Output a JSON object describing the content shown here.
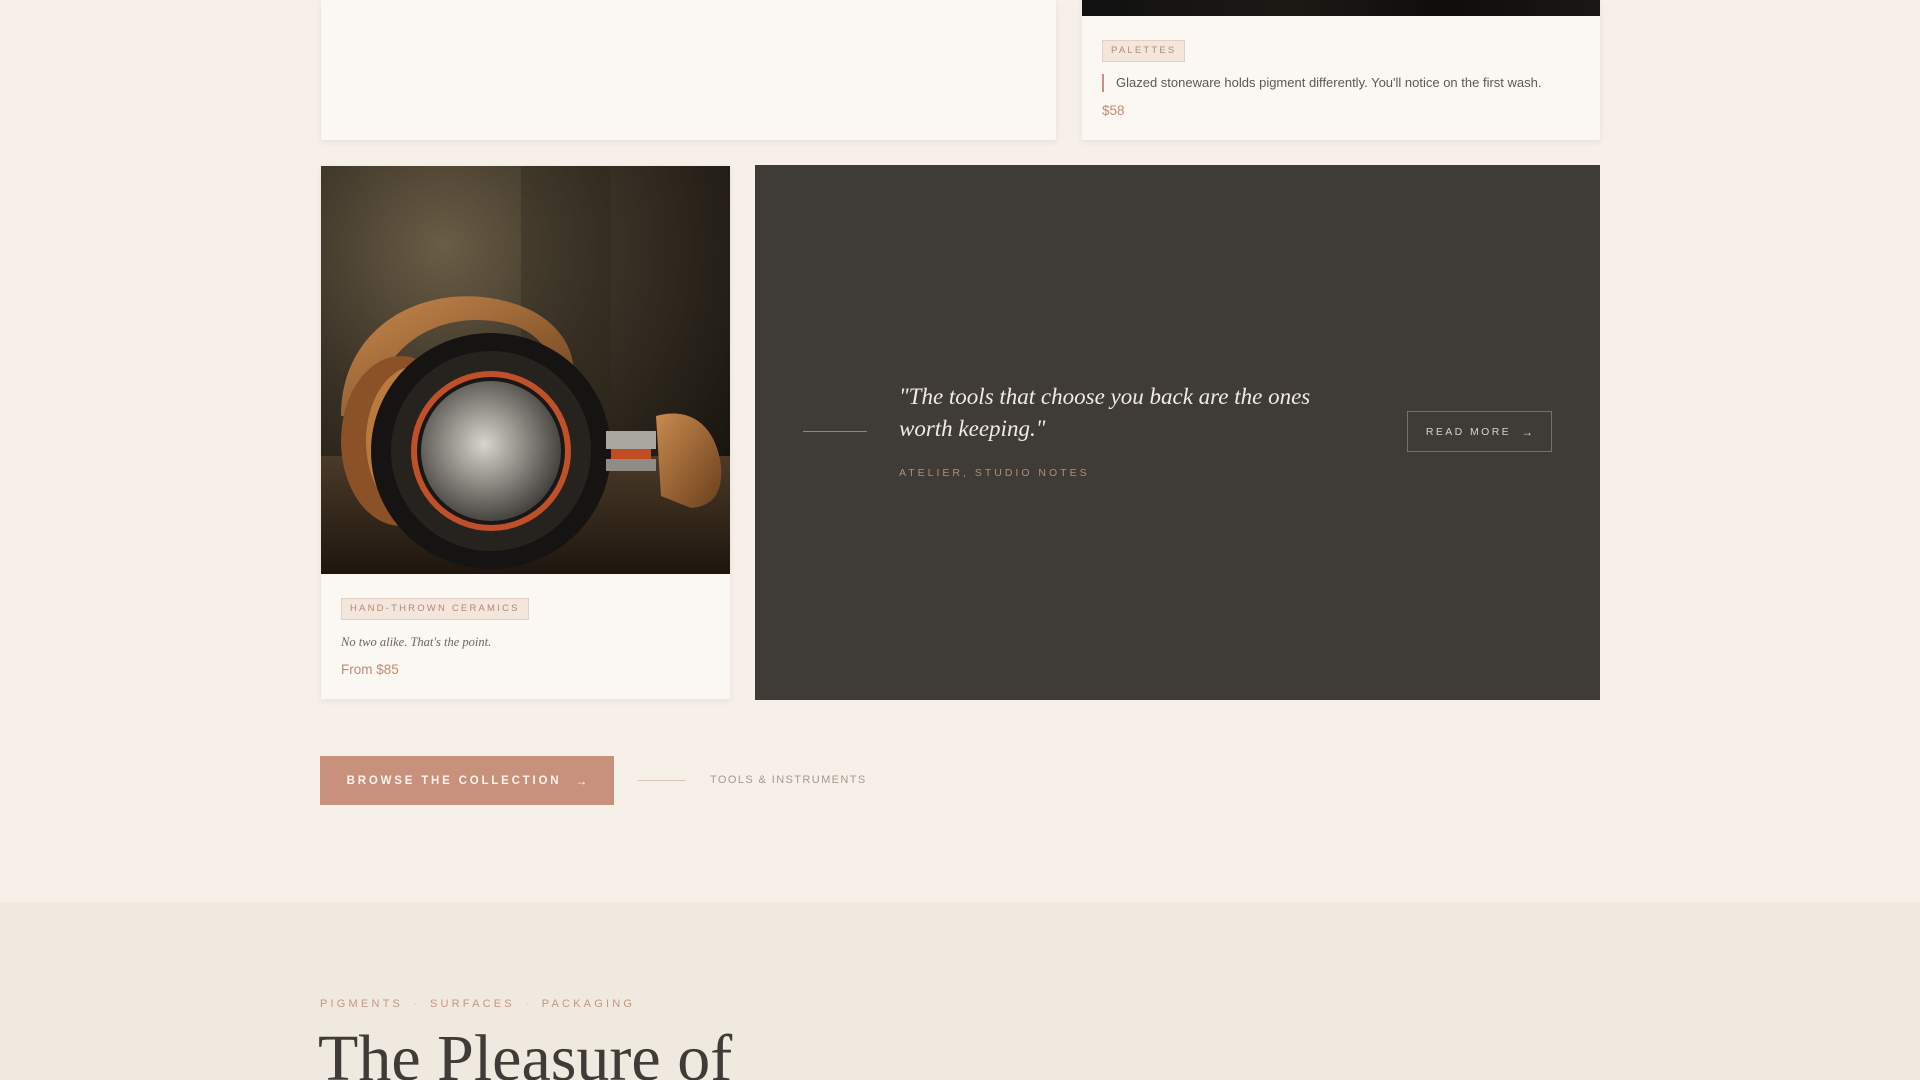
{
  "top_right_card": {
    "tag": "PALETTES",
    "note": "Glazed stoneware holds pigment differently. You'll notice on the first wash.",
    "price": "$58"
  },
  "ceramics_card": {
    "image_alt": "headphones",
    "tag": "HAND-THROWN CERAMICS",
    "note": "No two alike. That's the point.",
    "price": "From $85"
  },
  "quote_panel": {
    "quote": "\"The tools that choose you back are the ones worth keeping.\"",
    "attribution": "ATELIER, STUDIO NOTES",
    "read_more": "READ MORE",
    "arrow": "→"
  },
  "cta": {
    "label": "BROWSE THE COLLECTION",
    "arrow": "→",
    "sub_label": "TOOLS & INSTRUMENTS"
  },
  "lower_section": {
    "eyebrow": [
      "PIGMENTS",
      "SURFACES",
      "PACKAGING"
    ],
    "separator": "·",
    "title": "The Pleasure of"
  },
  "colors": {
    "accent": "#c8917b",
    "panel_dark": "#3f3c38",
    "background": "#f6f0e9"
  }
}
